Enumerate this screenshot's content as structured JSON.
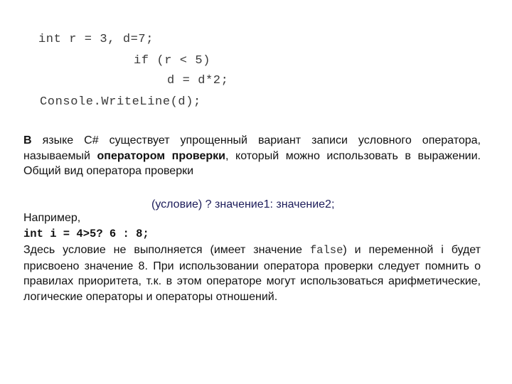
{
  "code_block": {
    "lines": [
      "int r = 3, d=7;",
      "if (r < 5)",
      "d = d*2;",
      "Console.WriteLine(d);"
    ]
  },
  "intro": {
    "lead_bold": "В",
    "part1": " языке C# существует упрощенный вариант записи условного оператора, называемый ",
    "term_bold": "оператором проверки",
    "part2": ", который можно использовать в выражении. Общий вид оператора проверки"
  },
  "formula": {
    "text": "(условие) ? значение1: значение2;",
    "color": "#1c1c5a"
  },
  "example": {
    "label": "Например,",
    "code": "int i = 4>5? 6 : 8;"
  },
  "explanation": {
    "part1": "Здесь условие не выполняется (имеет значение ",
    "keyword": "false",
    "part2": ") и переменной i будет присвоено значение 8. При использовании оператора проверки следует помнить о правилах приоритета, т.к. в этом операторе могут использоваться арифметические, логические операторы и операторы отношений."
  }
}
